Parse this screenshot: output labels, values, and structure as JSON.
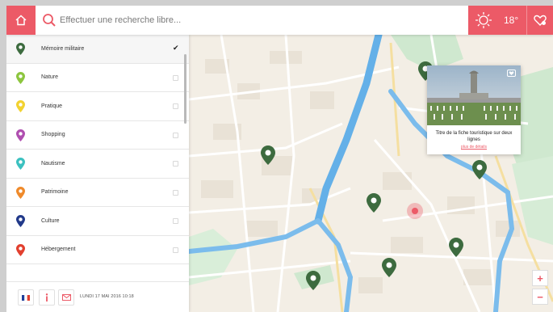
{
  "search": {
    "placeholder": "Effectuer une recherche libre..."
  },
  "weather": {
    "temperature": "18°"
  },
  "categories": [
    {
      "label": "Mémoire militaire",
      "color": "#3d6b3f",
      "checked": true
    },
    {
      "label": "Nature",
      "color": "#8dc63f",
      "checked": false
    },
    {
      "label": "Pratique",
      "color": "#f2d230",
      "checked": false
    },
    {
      "label": "Shopping",
      "color": "#b04fb0",
      "checked": false
    },
    {
      "label": "Nautisme",
      "color": "#3cc1c0",
      "checked": false
    },
    {
      "label": "Patrimoine",
      "color": "#ef8a2b",
      "checked": false
    },
    {
      "label": "Culture",
      "color": "#223a8a",
      "checked": false
    },
    {
      "label": "Hébergement",
      "color": "#e2402f",
      "checked": false
    }
  ],
  "footer": {
    "date": "LUNDI 17 MAI 2016 10:18"
  },
  "popup": {
    "title": "Titre de la fiche touristique sur deux lignes",
    "more": "plus de détails"
  },
  "zoom": {
    "in": "+",
    "out": "−"
  },
  "colors": {
    "accent": "#ec5a67",
    "pin": "#3d6b3f",
    "water": "#5aa9e6",
    "park": "#c8e6c9"
  }
}
